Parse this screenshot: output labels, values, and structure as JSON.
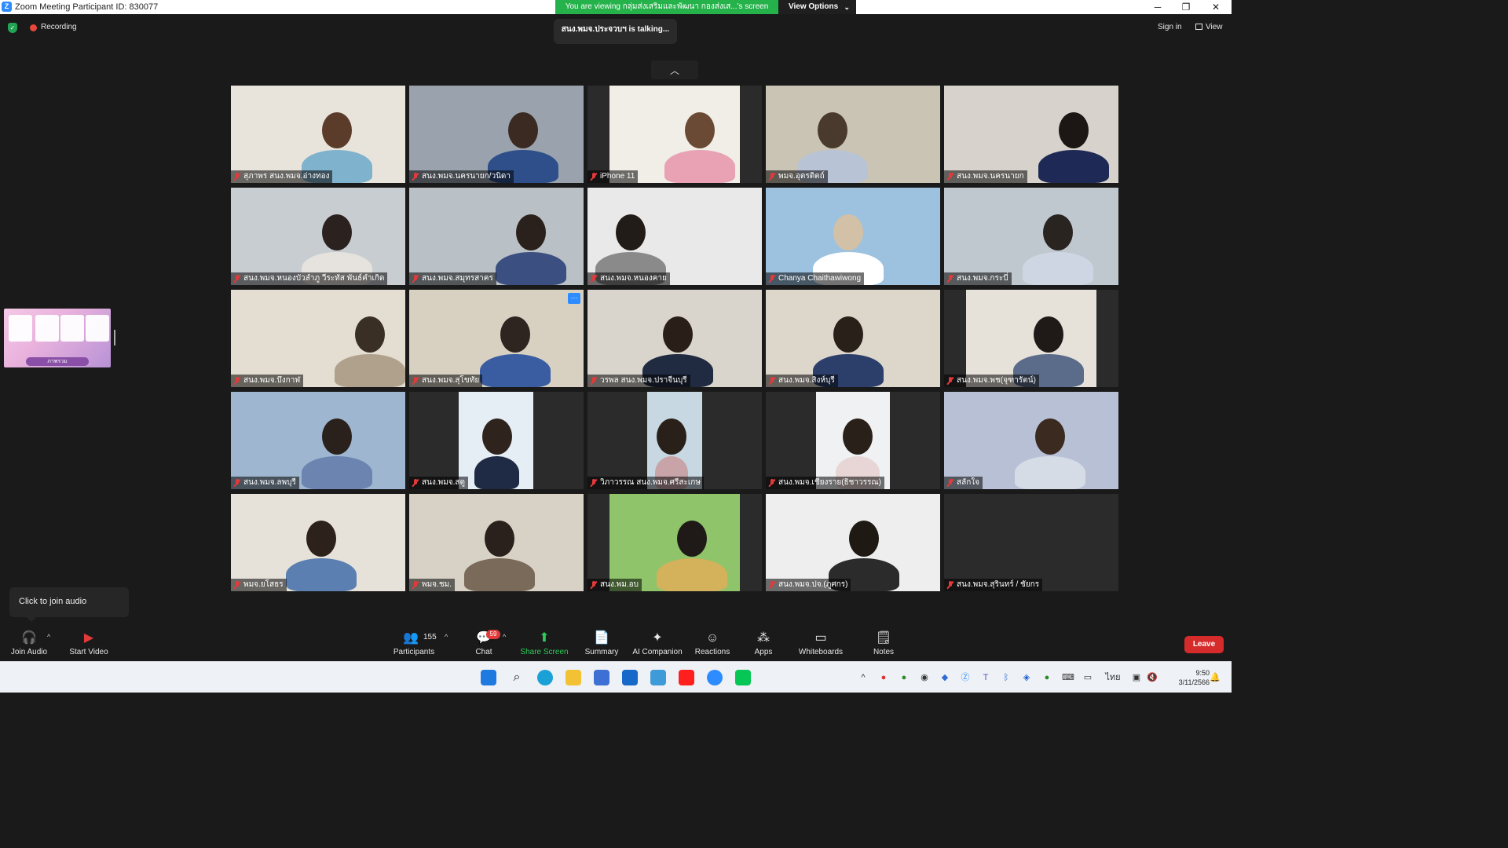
{
  "titlebar": {
    "title": "Zoom Meeting Participant ID: 830077",
    "minimize": "─",
    "restore": "❐",
    "close": "✕"
  },
  "share": {
    "banner": "You are viewing กลุ่มส่งเสริมและพัฒนา กองส่งเส...'s screen",
    "view_options": "View Options"
  },
  "top": {
    "recording": "Recording",
    "talking": "สนง.พมจ.ประจวบฯ is  talking...",
    "sign_in": "Sign in",
    "view": "View"
  },
  "thumbnail": {
    "caption": "ภาพรวม"
  },
  "tiles": [
    {
      "name": "สุภาพร สนง.พมจ.อ่างทอง"
    },
    {
      "name": "สนง.พมจ.นครนายก/วนิดา"
    },
    {
      "name": "iPhone 11"
    },
    {
      "name": "พมจ.อุตรดิตถ์"
    },
    {
      "name": "สนง.พมจ.นครนายก"
    },
    {
      "name": "สนง.พมจ.หนองบัวลำภู วีระทัส พันธ์คำเกิด"
    },
    {
      "name": "สนง.พมจ.สมุทรสาคร"
    },
    {
      "name": "สนง.พมจ.หนองคาย"
    },
    {
      "name": "Chanya Chaithawiwong"
    },
    {
      "name": "สนง.พมจ.กระบี่"
    },
    {
      "name": "สนง.พมจ.บึงกาฬ"
    },
    {
      "name": "สนง.พมจ.สุโขทัย"
    },
    {
      "name": "วรพล สนง.พมจ.ปราจีนบุรี"
    },
    {
      "name": "สนง.พมจ.สิงห์บุรี"
    },
    {
      "name": "สนง.พมจ.พช(จุฑารัตน์)"
    },
    {
      "name": "สนง.พมจ.ลพบุรี"
    },
    {
      "name": "สนง.พมจ.สตู"
    },
    {
      "name": "วิภาวรรณ สนง.พมจ.ศรีสะเกษ"
    },
    {
      "name": "สนง.พมจ.เชียงราย(ธิชาวรรณ)"
    },
    {
      "name": "สลักใจ"
    },
    {
      "name": "พมจ.ยโสธร"
    },
    {
      "name": "พมจ.ชม."
    },
    {
      "name": "สนง.พม.อบ"
    },
    {
      "name": "สนง.พมจ.ปจ.(ภูศกร)"
    },
    {
      "name": "สนง.พมจ.สุรินทร์ / ชัยกร"
    }
  ],
  "tooltip": "Click to join audio",
  "toolbar": {
    "join_audio": "Join Audio",
    "start_video": "Start Video",
    "participants": "Participants",
    "participant_count": "155",
    "chat": "Chat",
    "chat_badge": "59",
    "share_screen": "Share Screen",
    "summary": "Summary",
    "ai_companion": "AI Companion",
    "reactions": "Reactions",
    "apps": "Apps",
    "whiteboards": "Whiteboards",
    "notes": "Notes",
    "leave": "Leave"
  },
  "taskbar": {
    "language": "ไทย",
    "time": "9:50",
    "date": "3/11/2566"
  },
  "colors": {
    "accent_green": "#26b24b",
    "leave_red": "#d62b2b",
    "zoom_blue": "#2d8cff",
    "background": "#1a1a1a"
  }
}
